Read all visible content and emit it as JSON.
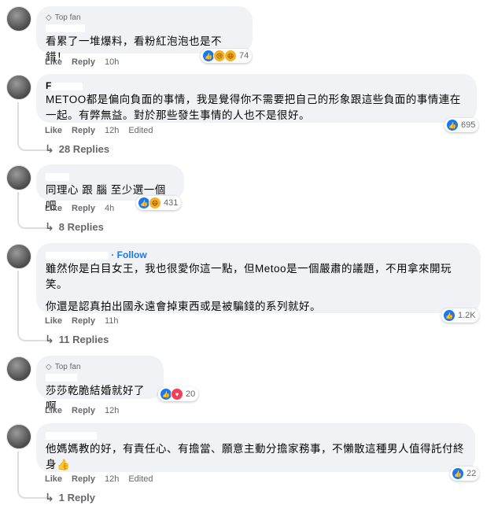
{
  "comments": [
    {
      "badge": "Top fan",
      "author": "",
      "text": [
        "看累了一堆爆料，看粉紅泡泡也是不錯！"
      ],
      "like": "Like",
      "reply": "Reply",
      "time": "10h",
      "edited": "",
      "reactions": [
        "like-icon",
        "sad-icon",
        "haha-icon"
      ],
      "reaction_count": "74",
      "replies": ""
    },
    {
      "badge": "",
      "author": "F",
      "text": [
        "METOO都是偏向負面的事情，我是覺得你不需要把自己的形象跟這些負面的事情連在一起。有弊無益。對於那些發生事情的人也不是很好。"
      ],
      "like": "Like",
      "reply": "Reply",
      "time": "12h",
      "edited": "Edited",
      "reactions": [
        "like-icon"
      ],
      "reaction_count": "695",
      "replies": "28 Replies"
    },
    {
      "badge": "",
      "author": "",
      "text": [
        "同理心 跟 腦 至少選一個吧"
      ],
      "like": "Like",
      "reply": "Reply",
      "time": "4h",
      "edited": "",
      "reactions": [
        "like-icon",
        "haha-icon"
      ],
      "reaction_count": "431",
      "replies": "8 Replies"
    },
    {
      "badge": "",
      "author": "",
      "follow": "· Follow",
      "text": [
        "雖然你是白目女王，我也很愛你這一點，但Metoo是一個嚴肅的議題，不用拿來開玩笑。",
        "你還是認真拍出國永遠會掉東西或是被騙錢的系列就好。"
      ],
      "like": "Like",
      "reply": "Reply",
      "time": "11h",
      "edited": "",
      "reactions": [
        "like-icon"
      ],
      "reaction_count": "1.2K",
      "replies": "11 Replies"
    },
    {
      "badge": "Top fan",
      "author": "",
      "text": [
        "莎莎乾脆結婚就好了啊"
      ],
      "like": "Like",
      "reply": "Reply",
      "time": "12h",
      "edited": "",
      "reactions": [
        "like-icon",
        "love-icon"
      ],
      "reaction_count": "20",
      "replies": ""
    },
    {
      "badge": "",
      "author": "",
      "text": [
        "他媽媽教的好，有責任心、有擔當、願意主動分擔家務事，不懶散這種男人值得託付終身👍"
      ],
      "like": "Like",
      "reply": "Reply",
      "time": "12h",
      "edited": "Edited",
      "reactions": [
        "like-icon"
      ],
      "reaction_count": "22",
      "replies": "1 Reply"
    }
  ],
  "colors": {
    "bubble": "#f0f2f5",
    "meta": "#65676b",
    "link": "#1877f2",
    "like": "#1877f2",
    "love": "#f33e58",
    "haha": "#f7b125"
  }
}
